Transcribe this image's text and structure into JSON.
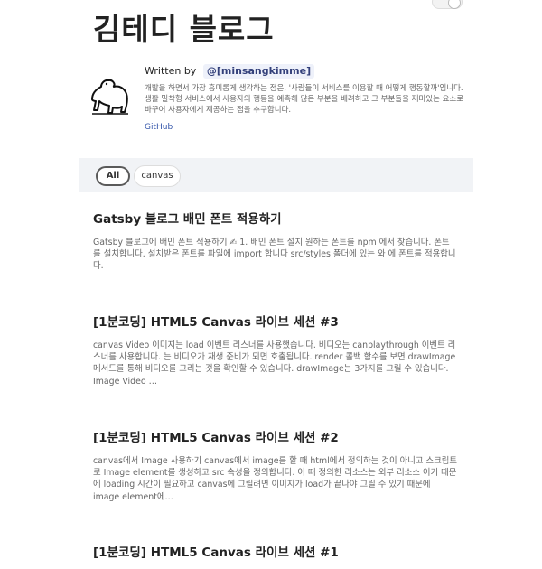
{
  "site": {
    "title": "김테디 블로그"
  },
  "bio": {
    "written_by": "Written by",
    "handle": "@[minsangkimme]",
    "description": "개발을 하면서 가장 흥미롭게 생각하는 점은, '사람들이 서비스를 이용할 때 어떻게 행동할까'입니다. 생활 밀착형 서비스에서 사용자의 행동을 예측해 많은 부분을 배려하고 그 부분들을 재미있는 요소로 바꾸어 사용자에게 제공하는 점을 추구합니다.",
    "github_label": "GitHub",
    "avatar_icon": "polar-bear-icon"
  },
  "categories": [
    "All",
    "canvas"
  ],
  "posts": [
    {
      "title": "Gatsby 블로그 배민 폰트 적용하기",
      "excerpt": "Gatsby 블로그에 배민 폰트 적용하기 ✍ 1. 배민 폰트 설치 원하는 폰트를 npm 에서 찾습니다. 폰트를 설치합니다. 설치받은 폰트를 파일에 import 합니다 src/styles 폴더에 있는 와 에 폰트를 적용합니다."
    },
    {
      "title": "[1분코딩] HTML5 Canvas 라이브 세션 #3",
      "excerpt": "canvas Video 이미지는 load 이벤트 리스너를 사용했습니다. 비디오는 canplaythrough 이벤트 리스너를 사용합니다. 는 비디오가 재생 준비가 되면 호출됩니다. render 콜백 함수를 보면 drawImage 메서드를 통해 비디오를 그리는 것을 확인할 수 있습니다. drawImage는 3가지를 그릴 수 있습니다. Image Video …"
    },
    {
      "title": "[1분코딩] HTML5 Canvas 라이브 세션 #2",
      "excerpt": "canvas에서 Image 사용하기 canvas에서 image를 할 때 html에서 정의하는 것이 아니고 스크립트로 Image element를 생성하고 src 속성을 정의합니다. 이 때 정의한 리소스는 외부 리소스 이기 때문에 loading 시간이 필요하고 canvas에 그릴려면 이미지가 load가 끝나야 그릴 수 있기 때문에 image element에…"
    },
    {
      "title": "[1분코딩] HTML5 Canvas 라이브 세션 #1",
      "excerpt": ""
    }
  ]
}
